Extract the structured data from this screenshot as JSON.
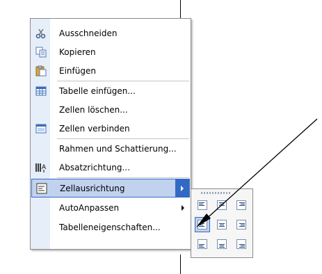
{
  "context_menu": {
    "items": [
      {
        "label": "Ausschneiden",
        "icon": "scissors-icon",
        "has_submenu": false
      },
      {
        "label": "Kopieren",
        "icon": "copy-icon",
        "has_submenu": false
      },
      {
        "label": "Einfügen",
        "icon": "paste-icon",
        "has_submenu": false
      },
      {
        "label": "Tabelle einfügen...",
        "icon": "insert-table-icon",
        "has_submenu": false
      },
      {
        "label": "Zellen löschen...",
        "icon": "",
        "has_submenu": false
      },
      {
        "label": "Zellen verbinden",
        "icon": "merge-cells-icon",
        "has_submenu": false
      },
      {
        "label": "Rahmen und Schattierung...",
        "icon": "",
        "has_submenu": false
      },
      {
        "label": "Absatzrichtung...",
        "icon": "text-direction-icon",
        "has_submenu": false
      },
      {
        "label": "Zellausrichtung",
        "icon": "cell-alignment-icon",
        "has_submenu": true,
        "selected": true
      },
      {
        "label": "AutoAnpassen",
        "icon": "",
        "has_submenu": true
      },
      {
        "label": "Tabelleneigenschaften...",
        "icon": "",
        "has_submenu": false
      }
    ]
  },
  "cell_alignment_palette": {
    "options": [
      {
        "name": "top-left"
      },
      {
        "name": "top-center"
      },
      {
        "name": "top-right"
      },
      {
        "name": "middle-left",
        "selected": true
      },
      {
        "name": "middle-center"
      },
      {
        "name": "middle-right"
      },
      {
        "name": "bottom-left"
      },
      {
        "name": "bottom-center"
      },
      {
        "name": "bottom-right"
      }
    ]
  },
  "colors": {
    "highlight": "#316ac5",
    "highlight_fill": "#c1d2ee",
    "gutter": "#e6eef9"
  }
}
